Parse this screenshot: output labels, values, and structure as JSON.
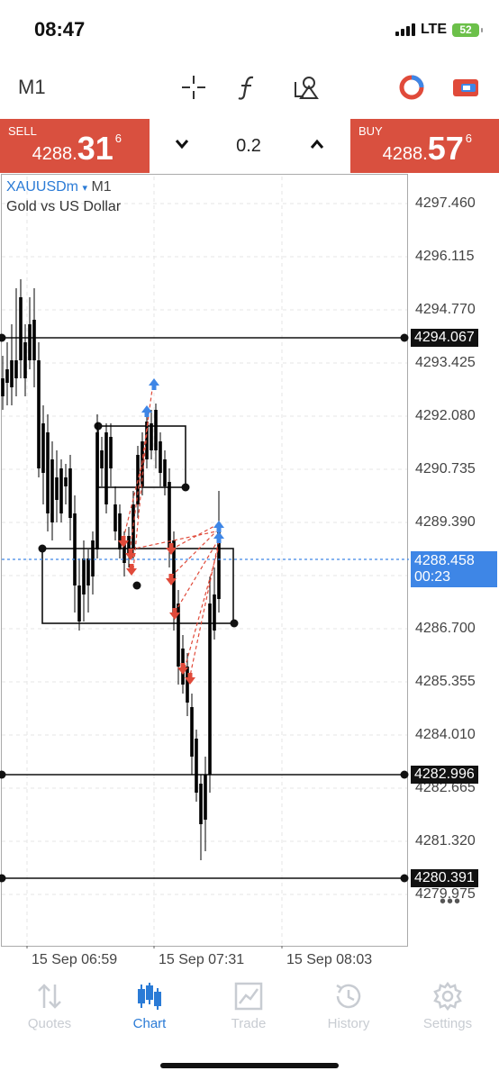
{
  "status_bar": {
    "time": "08:47",
    "network": "LTE",
    "battery": "52"
  },
  "toolbar": {
    "timeframe": "M1",
    "icons": [
      "crosshair-icon",
      "function-icon",
      "objects-icon",
      "indicators-icon",
      "trade-toggle-icon"
    ]
  },
  "trade": {
    "sell": {
      "label": "SELL",
      "price_main": "4288.",
      "price_big": "31",
      "price_sup": "6"
    },
    "buy": {
      "label": "BUY",
      "price_main": "4288.",
      "price_big": "57",
      "price_sup": "6"
    },
    "lot": "0.2"
  },
  "chart": {
    "symbol": "XAUUSDm",
    "symbol_arrow": "▾",
    "timeframe": "M1",
    "description": "Gold vs US Dollar",
    "price_axis": [
      "4297.460",
      "4296.115",
      "4294.770",
      "4293.425",
      "4292.080",
      "4290.735",
      "4289.390",
      "4286.700",
      "4285.355",
      "4284.010",
      "4282.665",
      "4281.320",
      "4279.975"
    ],
    "level_tags": [
      "4294.067",
      "4282.996",
      "4280.391"
    ],
    "current_price": "4288.458",
    "countdown": "00:23",
    "time_axis": [
      "15 Sep 06:59",
      "15 Sep 07:31",
      "15 Sep 08:03"
    ],
    "more": "•••",
    "colors": {
      "bull": "#3e86e6",
      "bear": "#000000",
      "sell_arrow": "#e04a3a",
      "buy_arrow": "#3e86e6",
      "current_line": "#3e86e6"
    }
  },
  "tabs": [
    {
      "label": "Quotes",
      "icon": "quotes-icon",
      "active": false
    },
    {
      "label": "Chart",
      "icon": "chart-icon",
      "active": true
    },
    {
      "label": "Trade",
      "icon": "trade-icon",
      "active": false
    },
    {
      "label": "History",
      "icon": "history-icon",
      "active": false
    },
    {
      "label": "Settings",
      "icon": "settings-icon",
      "active": false
    }
  ]
}
